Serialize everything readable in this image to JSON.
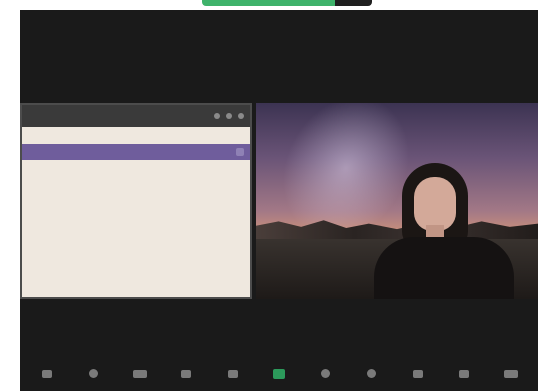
{
  "colors": {
    "background": "#1a1a1a",
    "share_green": "#3fb36b",
    "doc_header": "#6f5d9c",
    "document_bg": "#efe8df"
  },
  "top": {
    "share_indicator": ""
  },
  "doc": {
    "titlebar": "",
    "header": "",
    "lines": [],
    "links": []
  },
  "video": {
    "label": ""
  },
  "toolbar": {
    "buttons": [
      {
        "icon": "mic-icon"
      },
      {
        "icon": "security-icon"
      },
      {
        "icon": "video-icon"
      },
      {
        "icon": "participants-icon"
      },
      {
        "icon": "chat-icon"
      },
      {
        "icon": "share-screen-icon"
      },
      {
        "icon": "record-icon"
      },
      {
        "icon": "reactions-icon"
      },
      {
        "icon": "apps-icon"
      },
      {
        "icon": "more-icon"
      },
      {
        "icon": "end-icon"
      }
    ]
  }
}
